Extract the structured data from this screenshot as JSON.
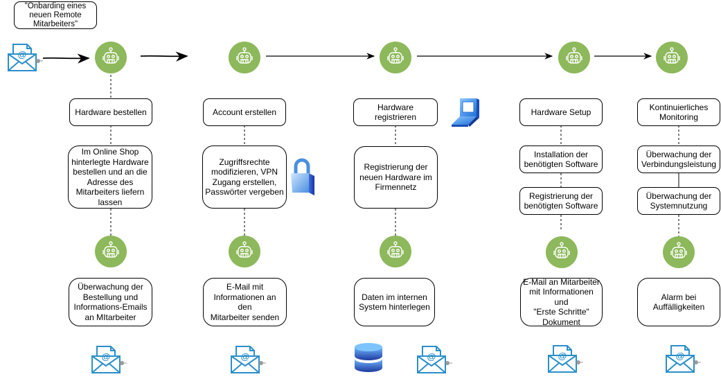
{
  "title_note": "\"Onbarding eines\nneuen Remote\nMitarbeiters\"",
  "colors": {
    "robot_green": "#8db85b",
    "mail_blue": "#2a8fc9",
    "line": "#000000"
  },
  "trigger_icon": "email-icon",
  "columns": [
    {
      "id": "hardware-bestellen",
      "header": "Hardware bestellen",
      "steps": [
        "Im Online Shop\nhinterlegte Hardware\nbestellen und an die\nAdresse des\nMitarbeiters liefern\nlassen"
      ],
      "result": "Überwachung der\nBestellung und\nInformations-Emails\nan MItarbeiter",
      "side_icon": null,
      "bottom_icons": [
        "email-icon"
      ]
    },
    {
      "id": "account-erstellen",
      "header": "Account erstellen",
      "steps": [
        "Zugriffsrechte\nmodifizieren, VPN\nZugang erstellen,\nPasswörter vergeben"
      ],
      "result": "E-Mail mit\nInformationen an den\nMitarbeiter senden",
      "side_icon": "lock-icon",
      "bottom_icons": [
        "email-icon"
      ]
    },
    {
      "id": "hardware-registrieren",
      "header": "Hardware registrieren",
      "steps": [
        "Registrierung der\nneuen Hardware im\nFirmennetz"
      ],
      "result": "Daten im internen\nSystem hinterlegen",
      "side_icon": "laptop-icon",
      "bottom_icons": [
        "database-icon",
        "email-icon"
      ]
    },
    {
      "id": "hardware-setup",
      "header": "Hardware Setup",
      "steps": [
        "Installation der\nbenötigten Software",
        "Registrierung der\nbenötigten Software"
      ],
      "result": "E-Mail an Mitarbeiter\nmit Informationen und\n\"Erste Schritte\"\nDokument",
      "side_icon": null,
      "bottom_icons": [
        "email-icon"
      ]
    },
    {
      "id": "kontinuierliches-monitoring",
      "header": "Kontinuierliches\nMonitoring",
      "steps": [
        "Überwachung der\nVerbindungsleistung",
        "Überwachung der\nSystemnutzung"
      ],
      "result": "Alarm bei\nAuffälligkeiten",
      "side_icon": null,
      "bottom_icons": [
        "email-icon"
      ]
    }
  ]
}
